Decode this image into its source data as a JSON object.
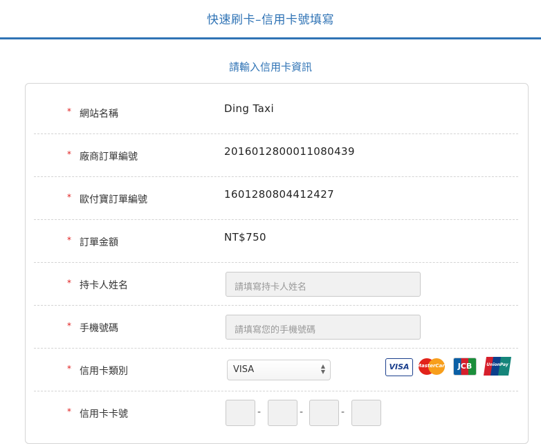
{
  "header": {
    "title": "快速刷卡–信用卡號填寫"
  },
  "form": {
    "subtitle": "請輸入信用卡資訊",
    "required_mark": "*",
    "site_name": {
      "label": "網站名稱",
      "value": "Ding Taxi"
    },
    "merchant_order": {
      "label": "廠商訂單編號",
      "value": "2016012800011080439"
    },
    "allpay_order": {
      "label": "歐付寶訂單編號",
      "value": "1601280804412427"
    },
    "amount": {
      "label": "訂單金額",
      "value": "NT$750"
    },
    "cardholder": {
      "label": "持卡人姓名",
      "placeholder": "請填寫持卡人姓名"
    },
    "phone": {
      "label": "手機號碼",
      "placeholder": "請填寫您的手機號碼"
    },
    "card_type": {
      "label": "信用卡類別",
      "selected": "VISA",
      "logos": [
        "VISA",
        "MasterCard",
        "JCB",
        "UnionPay"
      ]
    },
    "card_number": {
      "label": "信用卡卡號",
      "separator": "-"
    }
  },
  "colors": {
    "accent": "#2f73b5",
    "required": "#e02020"
  }
}
